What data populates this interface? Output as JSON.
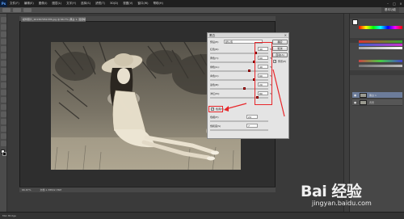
{
  "menubar": {
    "logo": "Ps",
    "items": [
      "文件(F)",
      "编辑(E)",
      "图像(I)",
      "图层(L)",
      "文字(Y)",
      "选择(S)",
      "滤镜(T)",
      "3D(D)",
      "视图(V)",
      "窗口(W)",
      "帮助(H)"
    ],
    "window_controls": [
      "–",
      "□",
      "×"
    ]
  },
  "options": {
    "essentials": "基本功能"
  },
  "document": {
    "tab_title": "模特照片_201307051335.jpg @ 66.7% (黑白 1, 图层蒙版/8)",
    "tab_close": "×",
    "status_zoom": "66.67%",
    "status_doc": "文档:1.38M/2.76M"
  },
  "dialog": {
    "title": "黑白",
    "close": "×",
    "preset_label": "预设(E):",
    "preset_value": "默认值",
    "rows": [
      {
        "label": "红色(R):",
        "value": "40",
        "unit": "%"
      },
      {
        "label": "黄色(Y):",
        "value": "60",
        "unit": "%"
      },
      {
        "label": "绿色(G):",
        "value": "40",
        "unit": "%"
      },
      {
        "label": "青色(C):",
        "value": "60",
        "unit": "%"
      },
      {
        "label": "蓝色(B):",
        "value": "20",
        "unit": "%"
      },
      {
        "label": "洋红(M):",
        "value": "80",
        "unit": "%"
      }
    ],
    "tint_label": "色调(T)",
    "tint_checked": true,
    "hue_label": "色相(H)",
    "hue_value": "24",
    "saturation_label": "饱和度(S)",
    "saturation_value": "7",
    "buttons": {
      "ok": "确定",
      "cancel": "取消",
      "auto": "自动(A)"
    },
    "preview_label": "预览(P)",
    "preview_checked": true
  },
  "layers": [
    {
      "name": "黑白 1",
      "active": true
    },
    {
      "name": "背景",
      "active": false
    }
  ],
  "bottombar": {
    "text": "Mini Bridge"
  },
  "watermark": {
    "brand": "Bai 经验",
    "url": "jingyan.baidu.com"
  },
  "colors": {
    "accent_red": "#e8262a",
    "photo_tone": "#9c937f",
    "panel_bg": "#474747"
  }
}
